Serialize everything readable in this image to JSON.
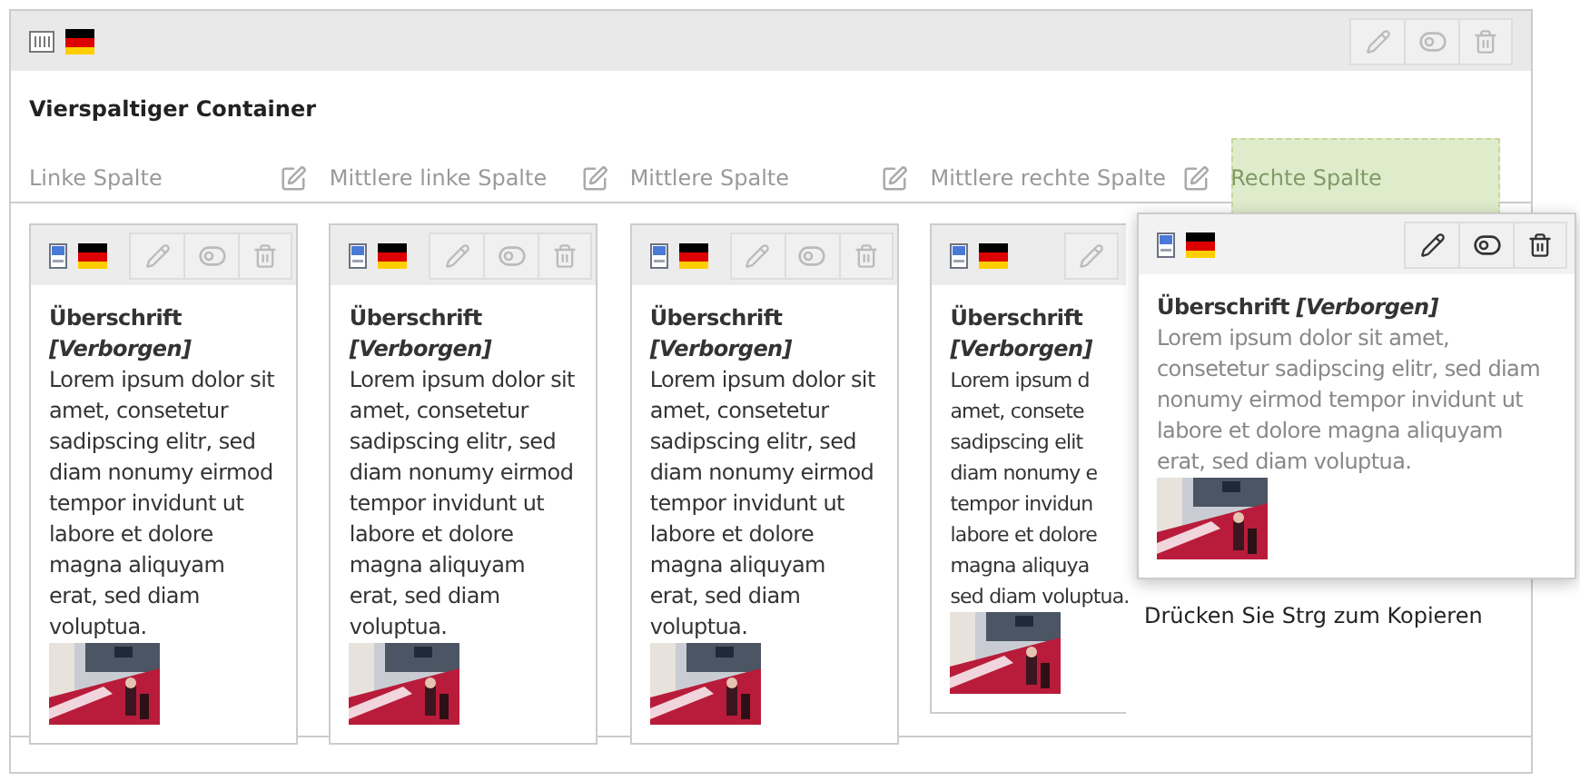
{
  "container": {
    "title": "Vierspaltiger Container",
    "buttons": [
      {
        "kind": "edit",
        "disabled": true
      },
      {
        "kind": "toggle",
        "disabled": true
      },
      {
        "kind": "delete",
        "disabled": true
      }
    ]
  },
  "columns": [
    {
      "label": "Linke Spalte",
      "drop_target": false,
      "cards": [
        {
          "heading": "Überschrift",
          "status": "[Verborgen]",
          "body": "Lorem ipsum dolor sit amet, consetetur sadipscing elitr, sed diam nonumy eirmod tempor invidunt ut labore et dolore magna aliquyam erat, sed diam voluptua.",
          "kind": "picture",
          "buttons": [
            {
              "kind": "edit",
              "disabled": true
            },
            {
              "kind": "toggle",
              "disabled": true
            },
            {
              "kind": "delete",
              "disabled": true
            }
          ]
        }
      ]
    },
    {
      "label": "Mittlere linke Spalte",
      "drop_target": false,
      "cards": [
        {
          "heading": "Überschrift",
          "status": "[Verborgen]",
          "body": "Lorem ipsum dolor sit amet, consetetur sadipscing elitr, sed diam nonumy eirmod tempor invidunt ut labore et dolore magna aliquyam erat, sed diam voluptua.",
          "kind": "picture",
          "buttons": [
            {
              "kind": "edit",
              "disabled": true
            },
            {
              "kind": "toggle",
              "disabled": true
            },
            {
              "kind": "delete",
              "disabled": true
            }
          ]
        }
      ]
    },
    {
      "label": "Mittlere Spalte",
      "drop_target": false,
      "cards": [
        {
          "heading": "Überschrift",
          "status": "[Verborgen]",
          "body": "Lorem ipsum dolor sit amet, consetetur sadipscing elitr, sed diam nonumy eirmod tempor invidunt ut labore et dolore magna aliquyam erat, sed diam voluptua.",
          "kind": "picture",
          "buttons": [
            {
              "kind": "edit",
              "disabled": true
            },
            {
              "kind": "toggle",
              "disabled": true
            },
            {
              "kind": "delete",
              "disabled": true
            }
          ]
        }
      ]
    },
    {
      "label": "Mittlere rechte Spalte",
      "drop_target": false,
      "cards": [
        {
          "heading": "Überschrift",
          "status": "[Verborgen]",
          "lines": [
            "Lorem ipsum d",
            "amet, consete",
            "sadipscing elit",
            "diam nonumy e",
            "tempor invidun",
            "labore et dolore",
            "magna aliquya",
            "sed diam voluptua."
          ],
          "kind": "picture",
          "buttons": [
            {
              "kind": "edit",
              "disabled": true
            }
          ]
        }
      ]
    },
    {
      "label": "Rechte Spalte",
      "drop_target": true
    }
  ],
  "drag_preview": {
    "heading": "Überschrift",
    "status": "[Verborgen]",
    "body": "Lorem ipsum dolor sit amet, consetetur sadipscing elitr, sed diam nonumy eirmod tempor invidunt ut labore et dolore magna aliquyam erat, sed diam voluptua.",
    "kind": "picture",
    "buttons": [
      {
        "kind": "edit",
        "disabled": false
      },
      {
        "kind": "toggle",
        "disabled": false
      },
      {
        "kind": "delete",
        "disabled": false
      }
    ]
  },
  "hint": "Drücken Sie Strg zum Kopieren"
}
